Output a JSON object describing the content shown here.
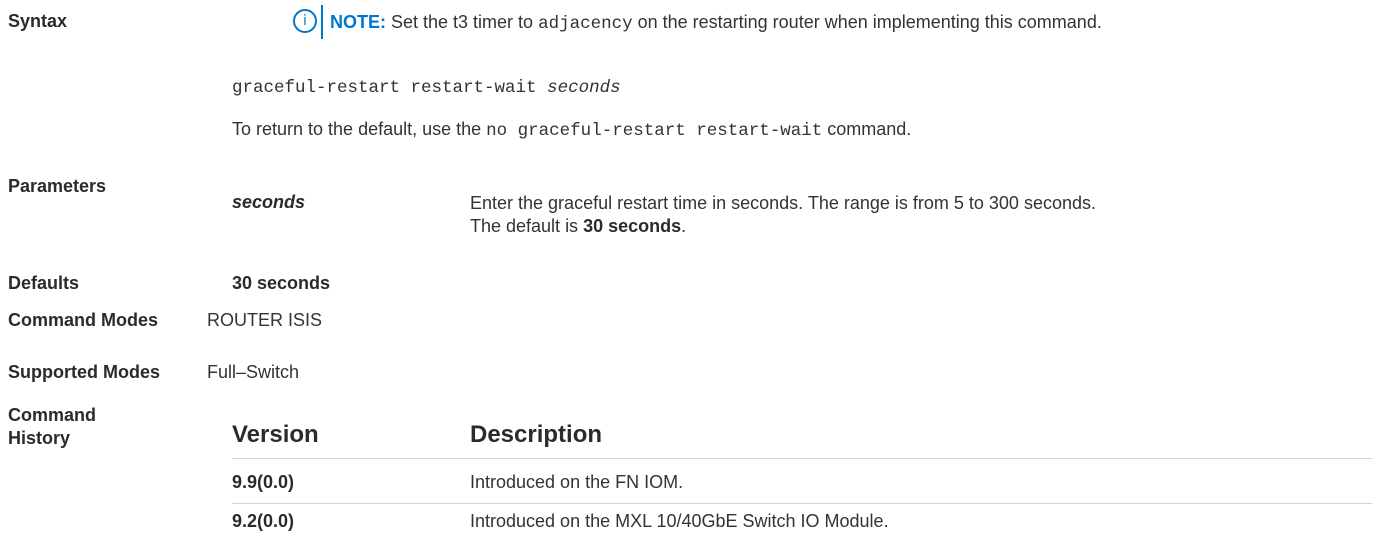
{
  "syntax": {
    "label": "Syntax",
    "note_label": "NOTE:",
    "note_text_before": " Set the t3 timer to ",
    "note_code": "adjacency",
    "note_text_after": " on the restarting router when implementing this command.",
    "command_text": "graceful-restart restart-wait ",
    "command_arg": "seconds",
    "return_text_before": "To return to the default, use the ",
    "return_code": "no graceful-restart restart-wait",
    "return_text_after": " command."
  },
  "parameters": {
    "label": "Parameters",
    "term": "seconds",
    "desc_line1": "Enter the graceful restart time in seconds. The range is from 5 to 300 seconds.",
    "desc_line2_before": "The default is ",
    "desc_line2_bold": "30 seconds",
    "desc_line2_after": "."
  },
  "defaults": {
    "label": "Defaults",
    "value": "30 seconds"
  },
  "command_modes": {
    "label": "Command Modes",
    "value": "ROUTER ISIS"
  },
  "supported_modes": {
    "label": "Supported Modes",
    "value": "Full–Switch"
  },
  "command_history": {
    "label_line1": "Command",
    "label_line2": "History",
    "headers": {
      "version": "Version",
      "description": "Description"
    },
    "rows": [
      {
        "version": "9.9(0.0)",
        "description": "Introduced on the FN IOM."
      },
      {
        "version": "9.2(0.0)",
        "description": "Introduced on the MXL 10/40GbE Switch IO Module."
      }
    ]
  },
  "icons": {
    "note": "info-icon"
  },
  "colors": {
    "accent": "#0076ce",
    "text": "#333333"
  }
}
